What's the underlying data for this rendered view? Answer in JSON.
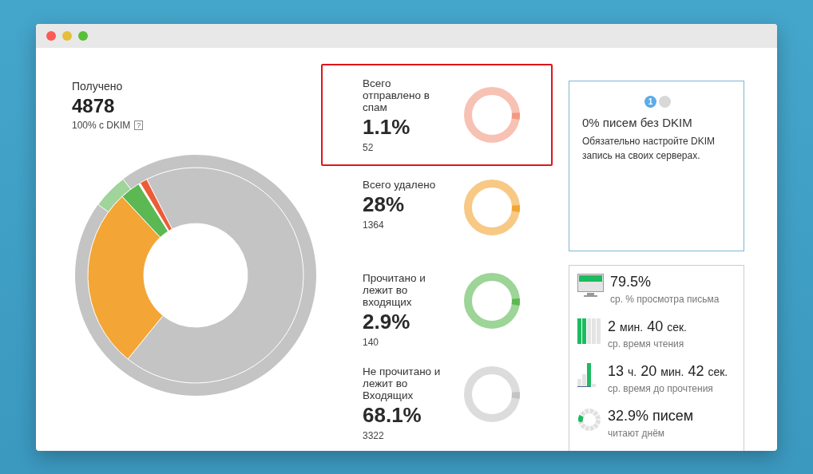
{
  "summary": {
    "label": "Получено",
    "value": "4878",
    "note": "100% с DKIM",
    "help": "?"
  },
  "stats": [
    {
      "label": "Всего отправлено в спам",
      "value": "1.1%",
      "count": "52",
      "color": "#f29a80",
      "selected": true
    },
    {
      "label": "Всего удалено",
      "value": "28%",
      "count": "1364",
      "color": "#f2a534",
      "selected": false
    },
    {
      "label": "Прочитано и лежит во входящих",
      "value": "2.9%",
      "count": "140",
      "color": "#5cb852",
      "selected": false
    },
    {
      "label": "Не прочитано и лежит во Входящих",
      "value": "68.1%",
      "count": "3322",
      "color": "#c4c4c4",
      "selected": false
    }
  ],
  "tip": {
    "pager": [
      {
        "label": "1",
        "selected": true
      },
      {
        "selected": false
      }
    ],
    "title": "0% писем без DKIM",
    "text": "Обязательно настройте DKIM запись на своих серверах."
  },
  "metrics": [
    {
      "kind": "monitor",
      "value": [
        {
          "text": "79.5%",
          "kind": "number"
        }
      ],
      "caption": "ср. % просмотра письма"
    },
    {
      "kind": "bars",
      "value": [
        {
          "text": "2",
          "kind": "number"
        },
        {
          "text": "мин.",
          "kind": "unit"
        },
        {
          "text": "40",
          "kind": "number"
        },
        {
          "text": "сек.",
          "kind": "unit"
        }
      ],
      "caption": "ср. время чтения"
    },
    {
      "kind": "histogram",
      "value": [
        {
          "text": "13",
          "kind": "number"
        },
        {
          "text": "ч.",
          "kind": "unit"
        },
        {
          "text": "20",
          "kind": "number"
        },
        {
          "text": "мин.",
          "kind": "unit"
        },
        {
          "text": "42",
          "kind": "number"
        },
        {
          "text": "сек.",
          "kind": "unit"
        }
      ],
      "caption": "ср. время до прочтения"
    },
    {
      "kind": "clock",
      "value": [
        {
          "text": "32.9% писем",
          "kind": "number"
        }
      ],
      "caption": "читают днём"
    }
  ]
}
